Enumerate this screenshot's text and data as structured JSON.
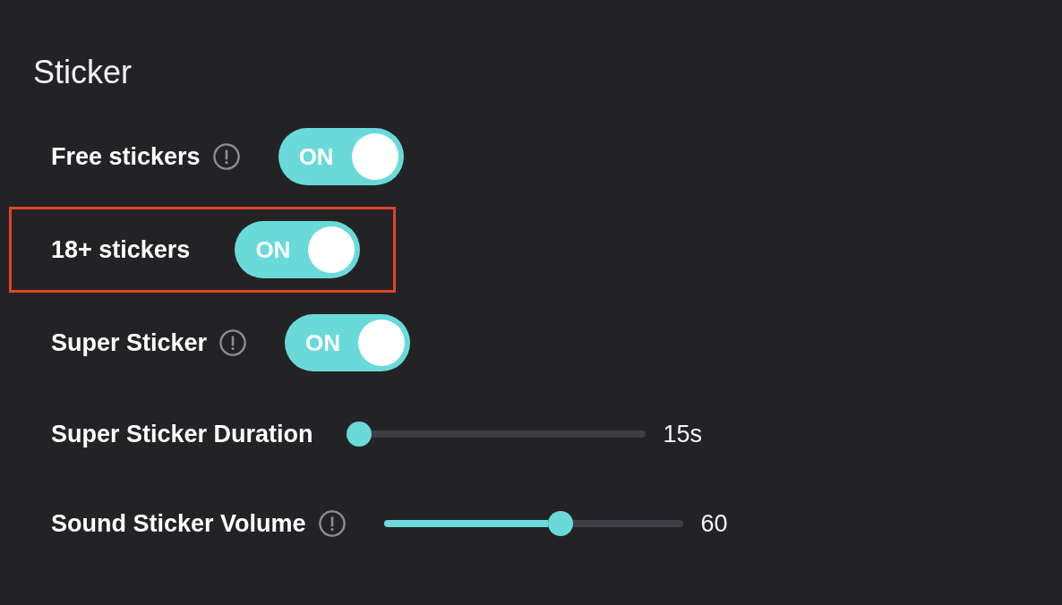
{
  "section": {
    "title": "Sticker"
  },
  "settings": [
    {
      "kind": "toggle",
      "label": "Free stickers",
      "info": true,
      "on": true,
      "switch_text": "ON",
      "highlighted": false
    },
    {
      "kind": "toggle",
      "label": "18+ stickers",
      "info": false,
      "on": true,
      "switch_text": "ON",
      "highlighted": true
    },
    {
      "kind": "toggle",
      "label": "Super Sticker",
      "info": true,
      "on": true,
      "switch_text": "ON",
      "highlighted": false
    },
    {
      "kind": "slider",
      "label": "Super Sticker Duration",
      "info": false,
      "level": 0,
      "reading": "15s",
      "highlighted": false
    },
    {
      "kind": "slider",
      "label": "Sound Sticker Volume",
      "info": true,
      "level": 0.6,
      "reading": "60",
      "highlighted": false
    }
  ]
}
